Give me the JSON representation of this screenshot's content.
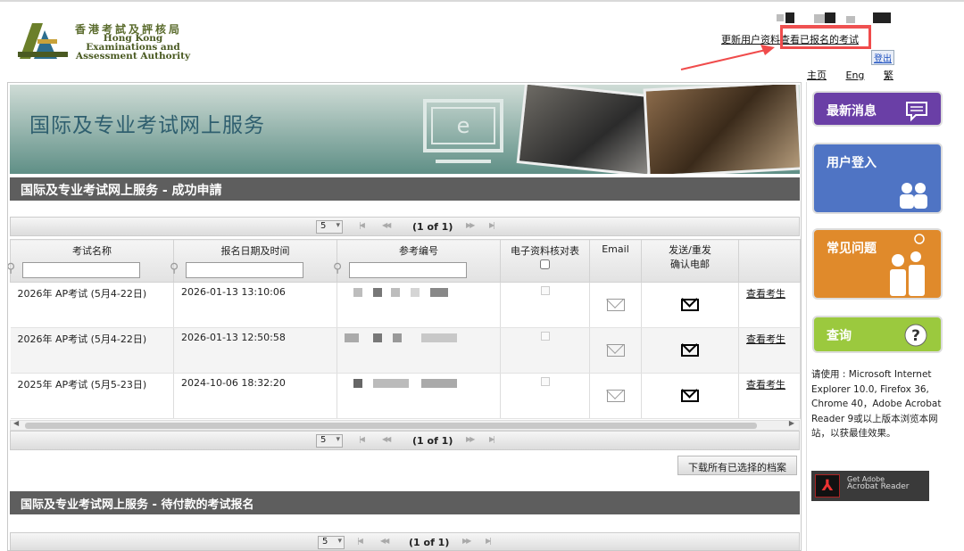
{
  "header": {
    "logo_zh": "香港考試及評核局",
    "logo_en_line1": "Hong Kong",
    "logo_en_line2": "Examinations and",
    "logo_en_line3": "Assessment Authority",
    "link_update_profile": "更新用户资料",
    "link_view_registered": "查看已报名的考试",
    "logout": "登出",
    "nav": [
      "主页",
      "Eng",
      "繁"
    ]
  },
  "banner": {
    "title": "国际及专业考试网上服务",
    "monitor_letter": "e"
  },
  "section_success": {
    "title": "国际及专业考试网上服务 - 成功申請",
    "pager": {
      "page_size": "5",
      "page_text": "(1 of 1)"
    },
    "columns": [
      "考试名称",
      "报名日期及时间",
      "参考编号",
      "电子资料核对表",
      "Email",
      "发送/重发\n确认电邮",
      ""
    ],
    "rows": [
      {
        "exam": "2026年 AP考试 (5月4-22日)",
        "datetime": "2026-01-13 13:10:06",
        "action": "查看考生"
      },
      {
        "exam": "2026年 AP考试 (5月4-22日)",
        "datetime": "2026-01-13 12:50:58",
        "action": "查看考生"
      },
      {
        "exam": "2025年 AP考试 (5月5-23日)",
        "datetime": "2024-10-06 18:32:20",
        "action": "查看考生"
      }
    ],
    "download_button": "下载所有已选择的档案"
  },
  "section_pending": {
    "title": "国际及专业考试网上服务 - 待付款的考试报名",
    "pager": {
      "page_size": "5",
      "page_text": "(1 of 1)"
    }
  },
  "sidebar": {
    "tiles": [
      {
        "label": "最新消息",
        "color": "#6a3fa6"
      },
      {
        "label": "用户登入",
        "color": "#4f74c4"
      },
      {
        "label": "常见问题",
        "color": "#e08a2b"
      },
      {
        "label": "查询",
        "color": "#9bc93e"
      }
    ],
    "browser_note": "请使用 : Microsoft Internet Explorer 10.0, Firefox 36, Chrome 40，Adobe Acrobat Reader 9或以上版本浏览本网站，以获最佳效果。",
    "adobe_line1": "Get Adobe",
    "adobe_line2": "Acrobat Reader"
  },
  "annotation": {
    "highlight_color": "#f04b4b"
  }
}
